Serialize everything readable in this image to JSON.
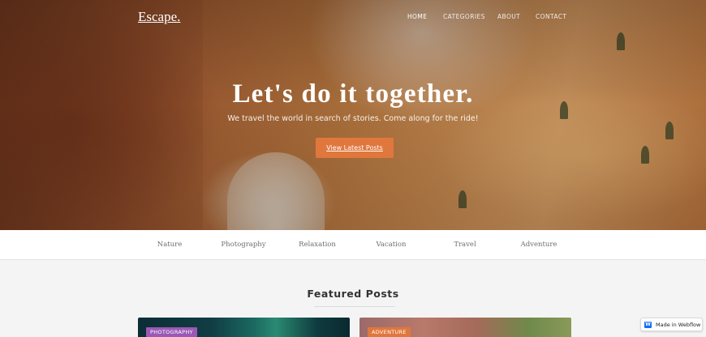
{
  "brand": "Escape.",
  "nav": {
    "items": [
      {
        "label": "HOME",
        "active": true
      },
      {
        "label": "CATEGORIES",
        "active": false
      },
      {
        "label": "ABOUT",
        "active": false
      },
      {
        "label": "CONTACT",
        "active": false
      }
    ]
  },
  "hero": {
    "headline": "Let's do it together.",
    "subheadline": "We travel the world in search of stories. Come along for the ride!",
    "cta_label": "View Latest Posts"
  },
  "categories": [
    "Nature",
    "Photography",
    "Relaxation",
    "Vacation",
    "Travel",
    "Adventure"
  ],
  "featured": {
    "title": "Featured Posts",
    "cards": [
      {
        "tag": "PHOTOGRAPHY",
        "tag_color": "#9b59b6"
      },
      {
        "tag": "ADVENTURE",
        "tag_color": "#e0773d"
      }
    ]
  },
  "badge": {
    "icon": "webflow-icon",
    "label": "Made in Webflow"
  },
  "colors": {
    "accent": "#e0773d",
    "photography_tag": "#9b59b6",
    "adventure_tag": "#e0773d"
  }
}
